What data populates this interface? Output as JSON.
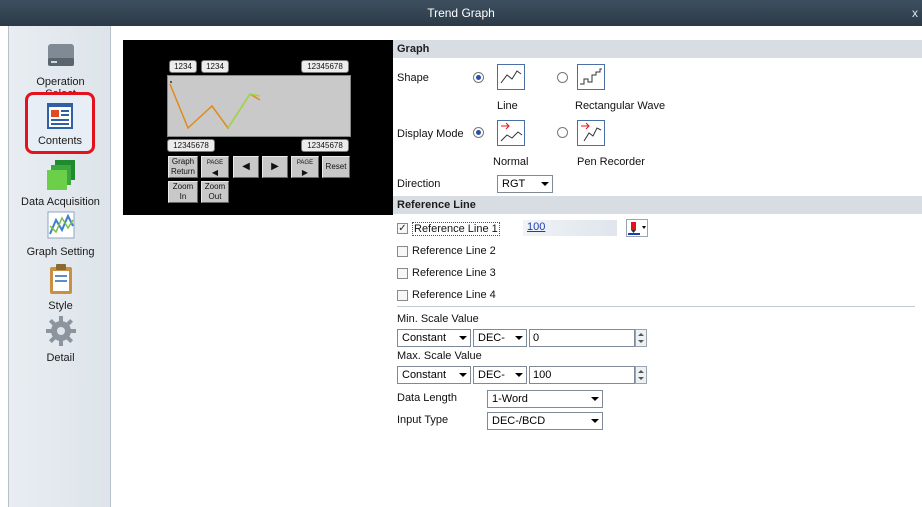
{
  "window": {
    "title": "Trend Graph",
    "close": "x"
  },
  "sidebar": {
    "items": [
      {
        "label": "Operation Select",
        "icon": "drive-icon"
      },
      {
        "label": "Contents",
        "icon": "document-icon"
      },
      {
        "label": "Data Acquisition",
        "icon": "stacked-squares-icon"
      },
      {
        "label": "Graph Setting",
        "icon": "line-graph-icon"
      },
      {
        "label": "Style",
        "icon": "clipboard-icon"
      },
      {
        "label": "Detail",
        "icon": "gear-icon"
      }
    ],
    "active": "Contents",
    "highlight_color": "#e3121d"
  },
  "preview": {
    "top_tags": [
      "1234",
      "1234",
      "12345678"
    ],
    "bottom_left_tag": "12345678",
    "bottom_right_tag": "12345678",
    "buttons": {
      "graph_return": "Graph Return",
      "page_prev": "PAGE",
      "prev": "◀",
      "next": "▶",
      "page_next": "PAGE",
      "reset": "Reset",
      "zoom_in": "Zoom In",
      "zoom_out": "Zoom Out"
    },
    "line_colors": [
      "#e08a1c",
      "#9bd84a"
    ]
  },
  "form": {
    "graph_section": "Graph",
    "shape_label": "Shape",
    "shape_options": [
      "Line",
      "Rectangular Wave"
    ],
    "shape_selected": "Line",
    "display_mode_label": "Display Mode",
    "display_mode_options": [
      "Normal",
      "Pen Recorder"
    ],
    "display_mode_selected": "Normal",
    "direction_label": "Direction",
    "direction_value": "RGT",
    "reference_section": "Reference Line",
    "reference_lines": [
      {
        "label": "Reference Line 1",
        "checked": true,
        "value": "100"
      },
      {
        "label": "Reference Line 2",
        "checked": false
      },
      {
        "label": "Reference Line 3",
        "checked": false
      },
      {
        "label": "Reference Line 4",
        "checked": false
      }
    ],
    "min_scale_label": "Min. Scale Value",
    "min_scale": {
      "type": "Constant",
      "format": "DEC-",
      "value": "0"
    },
    "max_scale_label": "Max. Scale Value",
    "max_scale": {
      "type": "Constant",
      "format": "DEC-",
      "value": "100"
    },
    "data_length_label": "Data Length",
    "data_length_value": "1-Word",
    "input_type_label": "Input Type",
    "input_type_value": "DEC-/BCD",
    "accent_color": "#2b4fa5"
  }
}
